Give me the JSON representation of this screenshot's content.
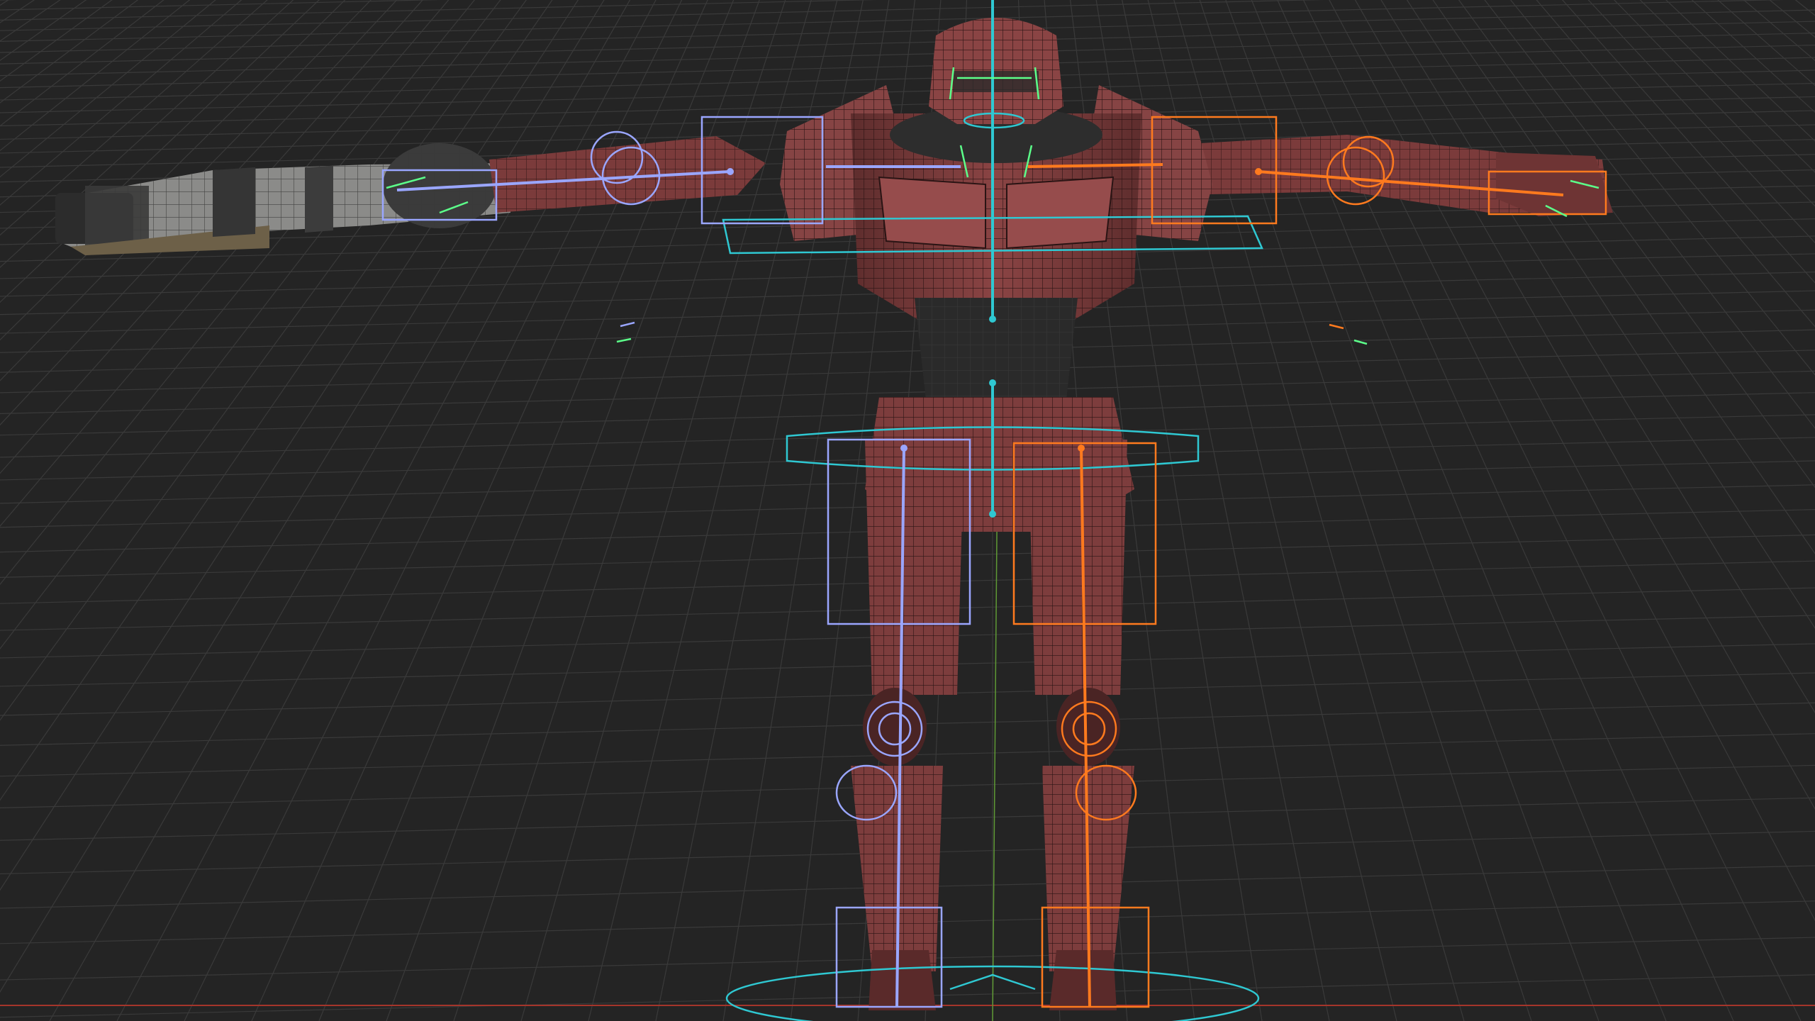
{
  "viewport": {
    "mode": "3d-perspective",
    "background": "#242424",
    "grid_color": "#3a3a3a",
    "x_axis_color": "#b0392e",
    "z_axis_color": "#6fae3a"
  },
  "model": {
    "mesh_color": "#7a3a3a",
    "mesh_dark": "#4a2323",
    "wire_color": "#2a1414",
    "weapon_color": "#8a8a88",
    "weapon_dark": "#2e2e2e"
  },
  "rig": {
    "center_color": "#2fc8d2",
    "left_color": "#9aa6ff",
    "right_color": "#ff7a1e",
    "face_color": "#5cff8a"
  }
}
